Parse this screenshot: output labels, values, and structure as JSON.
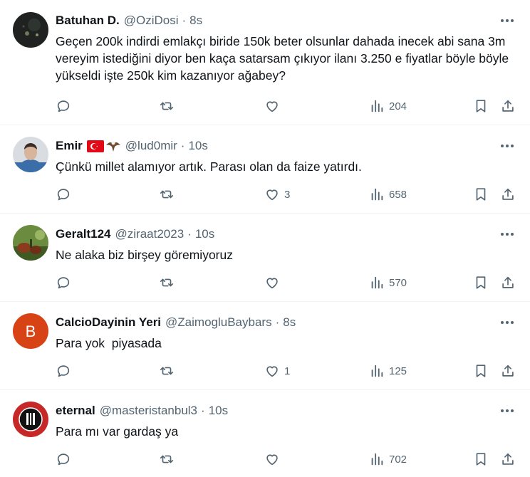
{
  "tweets": [
    {
      "name": "Batuhan D.",
      "handle": "@OziDosi",
      "time": "8s",
      "text": "Geçen 200k indirdi emlakçı biride 150k beter olsunlar dahada inecek abi sana 3m vereyim istediğini diyor ben kaça satarsam çıkıyor ilanı 3.250 e fiyatlar böyle böyle yükseldi işte 250k kim kazanıyor ağabey?",
      "likes": "",
      "views": "204",
      "avatar_color": "#1f2220"
    },
    {
      "name": "Emir",
      "handle": "@lud0mir",
      "time": "10s",
      "text": "Çünkü millet alamıyor artık. Parası olan da faize yatırdı.",
      "likes": "3",
      "views": "658",
      "avatar_color": "#3b6ea8"
    },
    {
      "name": "Geralt124",
      "handle": "@ziraat2023",
      "time": "10s",
      "text": "Ne alaka biz birşey göremiyoruz",
      "likes": "",
      "views": "570",
      "avatar_color": "#4a6a2a"
    },
    {
      "name": "CalcioDayinin Yeri",
      "handle": "@ZaimogluBaybars",
      "time": "8s",
      "text": "Para yok  piyasada",
      "likes": "1",
      "views": "125",
      "avatar_letter": "B",
      "avatar_color": "#d84315"
    },
    {
      "name": "eternal",
      "handle": "@masteristanbul3",
      "time": "10s",
      "text": "Para mı var gardaş ya",
      "likes": "",
      "views": "702",
      "avatar_color": "#c62828"
    }
  ],
  "colors": {
    "text": "#0f1419",
    "secondary": "#536471",
    "divider": "#eff3f4"
  }
}
